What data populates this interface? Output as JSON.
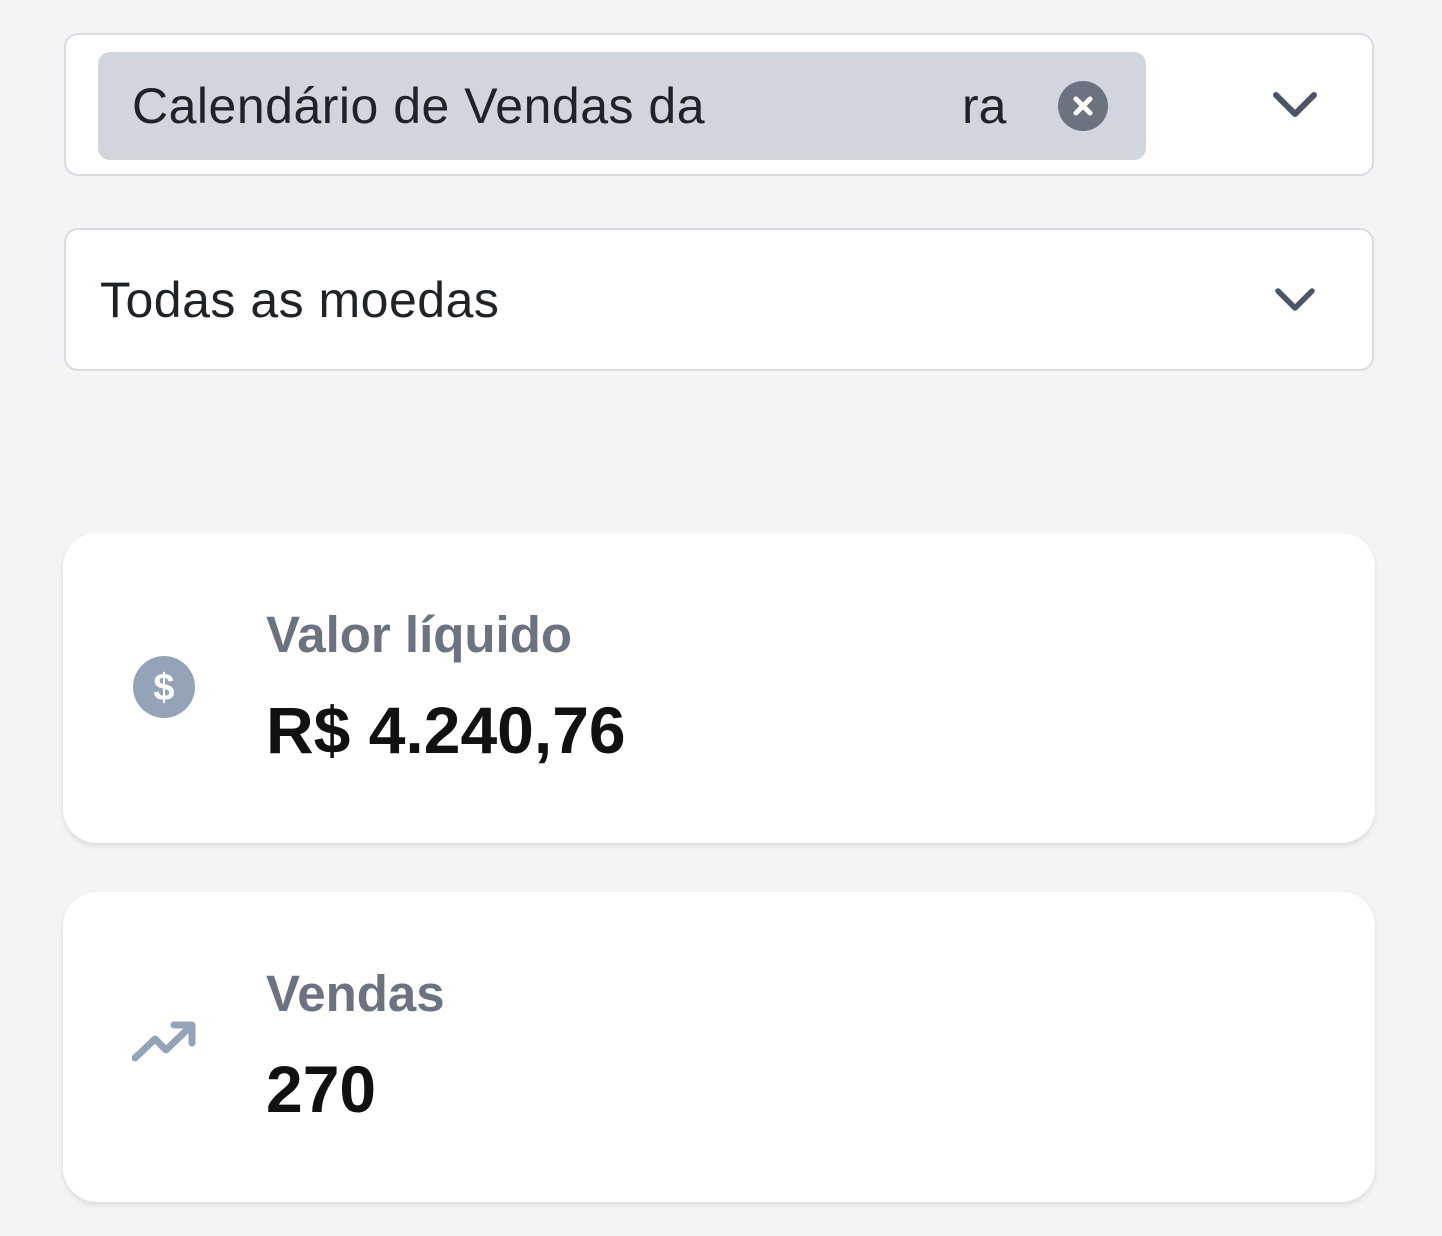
{
  "filters": {
    "product": {
      "chip_label": "Calendário de Vendas da",
      "chip_label_tail": "ra",
      "clear_icon": "close-circle-icon",
      "toggle_icon": "chevron-down-icon"
    },
    "currency": {
      "value": "Todas as moedas",
      "toggle_icon": "chevron-down-icon"
    }
  },
  "stats": [
    {
      "label": "Valor líquido",
      "value": "R$ 4.240,76",
      "icon": "dollar-circle-icon"
    },
    {
      "label": "Vendas",
      "value": "270",
      "icon": "trending-up-icon"
    }
  ],
  "colors": {
    "background": "#f3f4f6",
    "chip": "#d1d5de",
    "icon_muted": "#94a3b8",
    "label_muted": "#6b7280"
  }
}
